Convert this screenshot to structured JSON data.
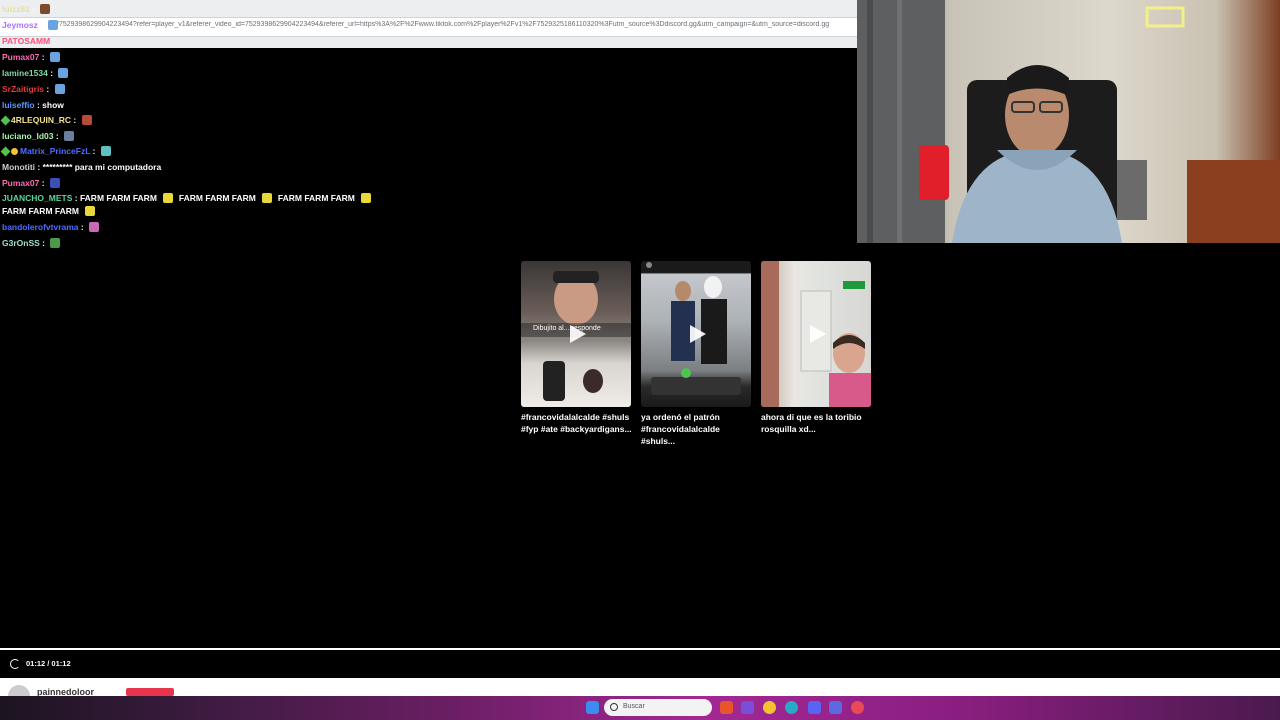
{
  "browser": {
    "url": "/7529398629904223494?refer=player_v1&referer_video_id=7529398629904223494&referer_url=https%3A%2F%2Fwww.tiktok.com%2Fplayer%2Fv1%2F7529325186110320%3Futm_source%3Ddiscord.gg&utm_campaign=&utm_source=discord.gg"
  },
  "chat": {
    "messages": [
      {
        "user": "luizz81",
        "text": "",
        "color": "#e6e29c"
      },
      {
        "user": "Jeymosz",
        "text": "",
        "color": "#a970ff"
      },
      {
        "user": "PATOSAMM",
        "text": "",
        "color": "#ff4f7b"
      },
      {
        "user": "Pumax07",
        "text": "",
        "color": "#ff69b4"
      },
      {
        "user": "lamine1534",
        "text": "",
        "color": "#7ad9a3"
      },
      {
        "user": "SrZaitigris",
        "text": "",
        "color": "#e23b3b"
      },
      {
        "user": "luiseffio",
        "text": "show",
        "color": "#5b9bff"
      },
      {
        "user": "4RLEQUIN_RC",
        "text": "",
        "color": "#f2e38d"
      },
      {
        "user": "luciano_ld03",
        "text": "",
        "color": "#a9f5ad"
      },
      {
        "user": "Matrix_PrinceFzL",
        "text": "",
        "color": "#4f6dff"
      },
      {
        "user": "Monotiti",
        "text": "********* para mi computadora",
        "color": "#cfcfcf"
      },
      {
        "user": "Pumax07",
        "text": "",
        "color": "#ff69b4"
      },
      {
        "user": "JUANCHO_METS",
        "text": "FARM FARM FARM",
        "text2": "FARM FARM FARM",
        "text3": "FARM FARM FARM",
        "text4": "FARM FARM FARM",
        "color": "#58d6a0"
      },
      {
        "user": "bandolerofvtvrama",
        "text": "",
        "color": "#4f6dff"
      },
      {
        "user": "G3rOnSS",
        "text": "",
        "color": "#9de1c6"
      }
    ]
  },
  "videos": [
    {
      "caption_line1": "#francovidalalcalde #shuls",
      "caption_line2": "#fyp #ate #backyardigans...",
      "overlay": "Dibujito al... responde"
    },
    {
      "caption_line1": "ya ordenó el patrón",
      "caption_line2": "#francovidalalcalde #shuls..."
    },
    {
      "caption_line1": "ahora di que es la toribio",
      "caption_line2": "rosquilla xd..."
    }
  ],
  "player": {
    "time": "01:12 / 01:12",
    "progress_fraction": 1.0
  },
  "strip": {
    "name": "painnedoloor"
  },
  "taskbar": {
    "search_placeholder": "Buscar"
  },
  "colors": {
    "accent_red": "#e8344d"
  }
}
